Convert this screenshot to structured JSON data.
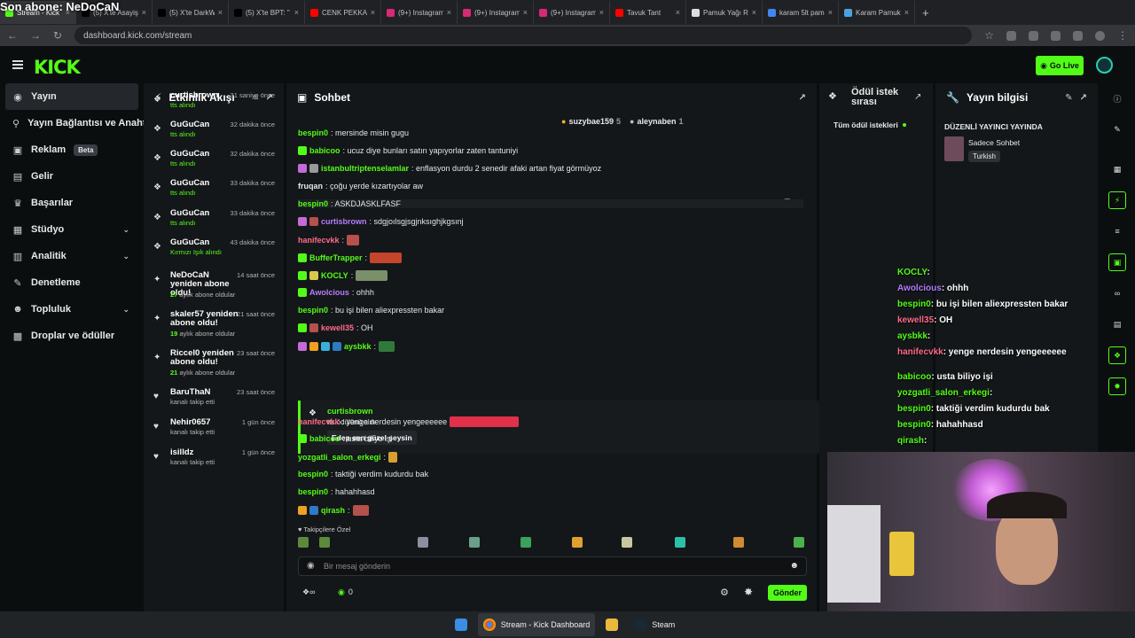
{
  "overlay_title": "Son abone: NeDoCaN",
  "browser": {
    "tabs": [
      {
        "label": "Stream - Kick",
        "icon": "kick-icon",
        "color": "#53fc18",
        "active": true
      },
      {
        "label": "(5) X'te Asayiş",
        "icon": "x-icon",
        "color": "#000000"
      },
      {
        "label": "(5) X'te DarkW",
        "icon": "x-icon",
        "color": "#000000"
      },
      {
        "label": "(5) X'te BPT: \"",
        "icon": "x-icon",
        "color": "#000000"
      },
      {
        "label": "CENK PEKKAN",
        "icon": "youtube-icon",
        "color": "#ff0000"
      },
      {
        "label": "(9+) Instagram",
        "icon": "instagram-icon",
        "color": "#d62976"
      },
      {
        "label": "(9+) Instagram",
        "icon": "instagram-icon",
        "color": "#d62976"
      },
      {
        "label": "(9+) Instagram",
        "icon": "instagram-icon",
        "color": "#d62976"
      },
      {
        "label": "Tavuk Tant",
        "icon": "youtube-icon",
        "color": "#ff0000"
      },
      {
        "label": "Pamuk Yağı R",
        "icon": "notion-icon",
        "color": "#dddddd"
      },
      {
        "label": "karam 5lt pam",
        "icon": "google-icon",
        "color": "#4285f4"
      },
      {
        "label": "Karam Pamuk",
        "icon": "check-icon",
        "color": "#4aa3df"
      }
    ],
    "url": "dashboard.kick.com/stream"
  },
  "header": {
    "logo": "KICK",
    "go_live": "Go Live"
  },
  "nav": {
    "items": [
      {
        "label": "Yayın",
        "icon": "broadcast-icon",
        "active": true
      },
      {
        "label": "Yayın Bağlantısı ve Anahtar",
        "icon": "key-icon"
      },
      {
        "label": "Reklam",
        "icon": "ad-icon",
        "badge": "Beta"
      },
      {
        "label": "Gelir",
        "icon": "money-icon"
      },
      {
        "label": "Başarılar",
        "icon": "trophy-icon"
      },
      {
        "label": "Stüdyo",
        "icon": "studio-icon",
        "expand": true
      },
      {
        "label": "Analitik",
        "icon": "chart-icon",
        "expand": true
      },
      {
        "label": "Denetleme",
        "icon": "hammer-icon"
      },
      {
        "label": "Topluluk",
        "icon": "people-icon",
        "expand": true
      },
      {
        "label": "Droplar ve ödüller",
        "icon": "gift-icon"
      }
    ]
  },
  "activity": {
    "title": "Etkinlik Akışı",
    "items": [
      {
        "name": "curtisbrown",
        "time": "31 saniye önce",
        "sub": "tts alındı",
        "icon": "reward-icon"
      },
      {
        "name": "GuGuCan",
        "time": "32 dakika önce",
        "sub": "tts alındı",
        "icon": "reward-icon"
      },
      {
        "name": "GuGuCan",
        "time": "32 dakika önce",
        "sub": "tts alındı",
        "icon": "reward-icon"
      },
      {
        "name": "GuGuCan",
        "time": "33 dakika önce",
        "sub": "tts alındı",
        "icon": "reward-icon"
      },
      {
        "name": "GuGuCan",
        "time": "33 dakika önce",
        "sub": "tts alındı",
        "icon": "reward-icon"
      },
      {
        "name": "GuGuCan",
        "time": "43 dakika önce",
        "sub": "Kırmızı Işık alındı",
        "icon": "reward-icon"
      },
      {
        "name": "NeDoCaN yeniden abone oldu!",
        "time": "14 saat önce",
        "sub_num": "27",
        "sub": "aylık abone oldular",
        "icon": "star-icon"
      },
      {
        "name": "skaler57 yeniden abone oldu!",
        "time": "21 saat önce",
        "sub_num": "19",
        "sub": "aylık abone oldular",
        "icon": "star-icon"
      },
      {
        "name": "Riccel0 yeniden abone oldu!",
        "time": "23 saat önce",
        "sub_num": "21",
        "sub": "aylık abone oldular",
        "icon": "star-icon"
      },
      {
        "name": "BaruThaN",
        "time": "23 saat önce",
        "sub": "kanalı takip etti",
        "icon": "heart-icon"
      },
      {
        "name": "Nehir0657",
        "time": "1 gün önce",
        "sub": "kanalı takip etti",
        "icon": "heart-icon"
      },
      {
        "name": "isilldz",
        "time": "1 gün önce",
        "sub": "kanalı takip etti",
        "icon": "heart-icon"
      }
    ]
  },
  "chat": {
    "title": "Sohbet",
    "pinned": [
      {
        "name": "suzybae159",
        "count": "5"
      },
      {
        "name": "aleynaben",
        "count": "1"
      }
    ],
    "messages": [
      {
        "user": "bespin0",
        "color": "#53fc18",
        "text": ": mersinde misin gugu",
        "badges": []
      },
      {
        "user": "babicoo",
        "color": "#53fc18",
        "text": ": ucuz diye bunları satın yapıyorlar zaten tantuniyi",
        "badges": [
          "#53fc18"
        ]
      },
      {
        "user": "istanbultriptenselamlar",
        "color": "#53fc18",
        "text": ": enflasyon durdu 2 senedir afaki artan fiyat görmüyoz",
        "badges": [
          "#c46ad9",
          "#9a9a9a"
        ]
      },
      {
        "user": "fruqan",
        "color": "#e6e6e6",
        "text": ": çoğu yerde kızartıyolar aw",
        "badges": []
      },
      {
        "user": "bespin0",
        "color": "#53fc18",
        "text": ": ASKDJASKLFASF",
        "badges": []
      },
      {
        "user": "curtisbrown",
        "color": "#b47dff",
        "text": ": sdgjoılsgjsgjnksıghjkgsınj",
        "badges": [
          "#c46ad9",
          "#b5504c"
        ]
      },
      {
        "user": "hanifecvkk",
        "color": "#ff6b8a",
        "text": ":",
        "badges": []
      },
      {
        "user": "BufferTrapper",
        "color": "#53fc18",
        "text": ":",
        "badges": [
          "#53fc18"
        ]
      },
      {
        "user": "KOCLY",
        "color": "#53fc18",
        "text": ":",
        "badges": [
          "#53fc18",
          "#d8c94a"
        ]
      },
      {
        "user": "Awolcious",
        "color": "#b47dff",
        "text": ": ohhh",
        "badges": [
          "#53fc18"
        ]
      },
      {
        "user": "bespin0",
        "color": "#53fc18",
        "text": ": bu işi bilen aliexpressten bakar",
        "badges": []
      },
      {
        "user": "kewell35",
        "color": "#ff6b8a",
        "text": ": OH",
        "badges": [
          "#53fc18",
          "#b5504c"
        ]
      },
      {
        "user": "aysbkk",
        "color": "#53fc18",
        "text": ":",
        "badges": [
          "#c46ad9",
          "#f0a020",
          "#3ab0d8",
          "#2f7ac4"
        ]
      },
      {
        "user": "hanifecvkk",
        "color": "#ff6b8a",
        "text": ": yenge nerdesin yengeeeeee",
        "badges": []
      },
      {
        "user": "babicoo",
        "color": "#53fc18",
        "text": ": usta biliyo işi",
        "badges": [
          "#53fc18"
        ]
      },
      {
        "user": "yozgatli_salon_erkegi",
        "color": "#53fc18",
        "text": ":",
        "badges": []
      },
      {
        "user": "bespin0",
        "color": "#53fc18",
        "text": ": taktiği verdim kudurdu bak",
        "badges": []
      },
      {
        "user": "bespin0",
        "color": "#53fc18",
        "text": ": hahahhasd",
        "badges": []
      },
      {
        "user": "qirash",
        "color": "#53fc18",
        "text": ":",
        "badges": [
          "#f0a020",
          "#2f7ac4"
        ]
      }
    ],
    "reward": {
      "user": "curtisbrown",
      "line": "tts ödülünü aldı",
      "message": "Edep sen güzel şeysin"
    },
    "followers_only": "Takipçilere Özel",
    "input_placeholder": "Bir mesaj gönderin",
    "points": "0",
    "send": "Gönder"
  },
  "rewards": {
    "title": "Ödül istek sırası",
    "filter": "Tüm ödül istekleri"
  },
  "streaminfo": {
    "title": "Yayın bilgisi",
    "headline": "DÜZENLİ YAYINCI YAYINDA",
    "category": "Sadece Sohbet",
    "tag": "Turkish"
  },
  "overlay_chat": [
    {
      "user": "KOCLY",
      "color": "#53fc18",
      "text": ":"
    },
    {
      "user": "Awolcious",
      "color": "#b47dff",
      "text": ": ohhh"
    },
    {
      "user": "bespin0",
      "color": "#53fc18",
      "text": ": bu işi bilen aliexpressten bakar"
    },
    {
      "user": "kewell35",
      "color": "#ff6b8a",
      "text": ": OH"
    },
    {
      "user": "aysbkk",
      "color": "#53fc18",
      "text": ":"
    },
    {
      "user": "hanifecvkk",
      "color": "#ff6b8a",
      "text": ": yenge nerdesin yengeeeeee"
    },
    {
      "user": "babicoo",
      "color": "#53fc18",
      "text": ": usta biliyo işi"
    },
    {
      "user": "yozgatli_salon_erkegi",
      "color": "#53fc18",
      "text": ":"
    },
    {
      "user": "bespin0",
      "color": "#53fc18",
      "text": ": taktiği verdim kudurdu bak"
    },
    {
      "user": "bespin0",
      "color": "#53fc18",
      "text": ": hahahhasd"
    },
    {
      "user": "qirash",
      "color": "#53fc18",
      "text": ":"
    }
  ],
  "taskbar": {
    "items": [
      {
        "label": "Stream - Kick Dashboard",
        "icon": "chrome-icon"
      },
      {
        "label": "Steam",
        "icon": "steam-icon"
      }
    ]
  },
  "colors": {
    "accent": "#53fc18",
    "panel": "#141719",
    "background": "#0b0e0f"
  }
}
